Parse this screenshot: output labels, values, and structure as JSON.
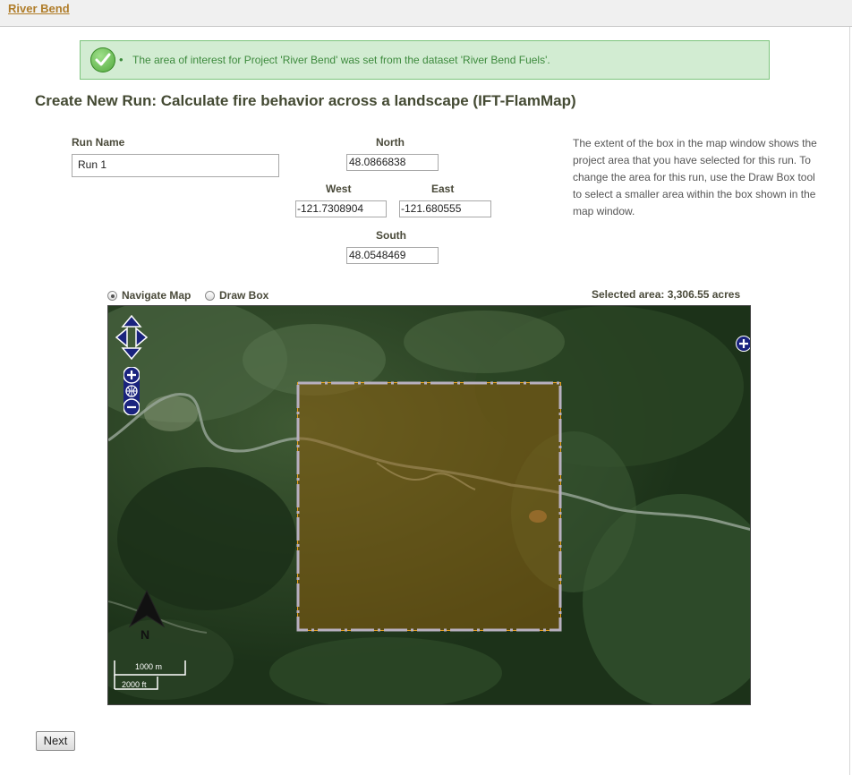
{
  "breadcrumb": {
    "project": "River Bend"
  },
  "alert": {
    "message": "The area of interest for Project 'River Bend' was set from the dataset 'River Bend Fuels'."
  },
  "page": {
    "title": "Create New Run: Calculate fire behavior across a landscape (IFT-FlamMap)"
  },
  "form": {
    "run_name_label": "Run Name",
    "run_name_value": "Run 1",
    "north_label": "North",
    "north_value": "48.0866838",
    "west_label": "West",
    "west_value": "-121.7308904",
    "east_label": "East",
    "east_value": "-121.680555",
    "south_label": "South",
    "south_value": "48.0548469"
  },
  "help_text": "The extent of the box in the map window shows the project area that you have selected for this run. To change the area for this run, use the Draw Box tool to select a smaller area within the box shown in the map window.",
  "map_tools": {
    "navigate_label": "Navigate Map",
    "draw_label": "Draw Box",
    "selected": "navigate",
    "selected_area": "Selected area: 3,306.55 acres"
  },
  "map": {
    "north_arrow_label": "N",
    "scale_metric": "1000 m",
    "scale_imperial": "2000 ft",
    "icons": [
      "pan-arrows-icon",
      "zoom-in-icon",
      "zoom-world-icon",
      "zoom-out-icon",
      "layer-switcher-plus-icon",
      "north-arrow-icon"
    ],
    "overlay_color": "#e8a020"
  },
  "actions": {
    "next_label": "Next"
  },
  "colors": {
    "link": "#b07d2a",
    "alert_bg": "#d2ecd2",
    "alert_text": "#3d8a3d",
    "heading": "#444a33",
    "map_control": "#1a237e"
  }
}
